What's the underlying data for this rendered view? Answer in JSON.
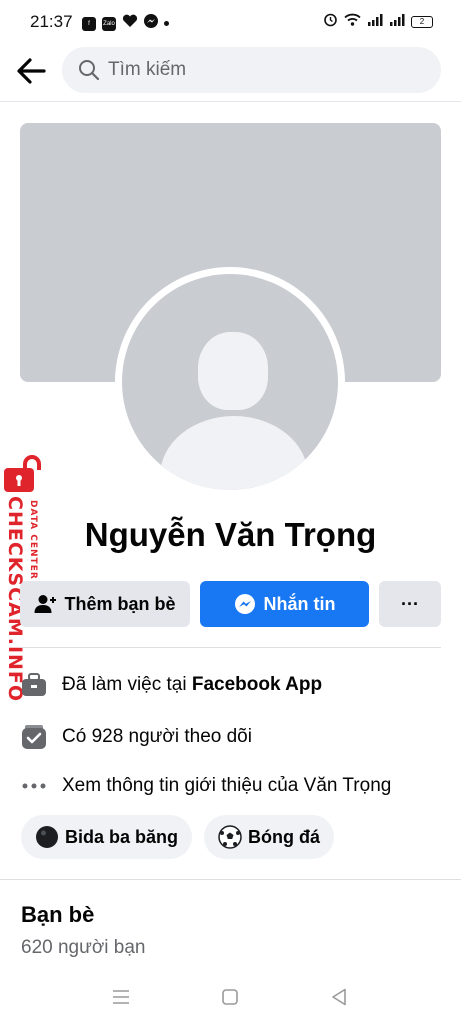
{
  "status_bar": {
    "time": "21:37",
    "battery": "2",
    "app_icons": [
      "facebook-icon",
      "zalo-icon",
      "heart-app-icon",
      "messenger-icon"
    ],
    "zalo_label": "Zalo"
  },
  "search": {
    "placeholder": "Tìm kiếm"
  },
  "profile": {
    "name": "Nguyễn Văn Trọng"
  },
  "actions": {
    "add_friend": "Thêm bạn bè",
    "message": "Nhắn tin",
    "more": "···"
  },
  "info": {
    "work_prefix": "Đã làm việc tại ",
    "work_place": "Facebook App",
    "followers": "Có 928 người theo dõi",
    "about": "Xem thông tin giới thiệu của Văn Trọng"
  },
  "hobbies": [
    {
      "label": "Bida ba băng",
      "icon": "billiard-ball-icon"
    },
    {
      "label": "Bóng đá",
      "icon": "soccer-ball-icon"
    }
  ],
  "friends": {
    "title": "Bạn bè",
    "count": "620 người bạn"
  },
  "watermark": {
    "main": "CHECKSCAM.INFO",
    "sub": "DATA CENTER"
  },
  "colors": {
    "accent": "#1877f2",
    "button_gray": "#e4e6eb",
    "cover": "#c9ccd1",
    "watermark": "#e0242b"
  }
}
